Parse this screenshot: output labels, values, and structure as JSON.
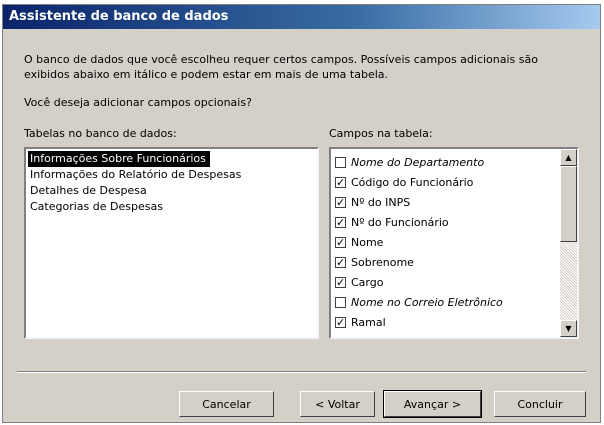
{
  "window": {
    "title": "Assistente de banco de dados"
  },
  "intro": {
    "line1": "O banco de dados que você escolheu requer certos campos. Possíveis campos adicionais são",
    "line2": "exibidos abaixo em itálico e podem estar em mais de uma tabela."
  },
  "question": "Você deseja adicionar campos opcionais?",
  "tables": {
    "label": "Tabelas no banco de dados:",
    "items": [
      {
        "label": "Informações Sobre Funcionários",
        "selected": true
      },
      {
        "label": "Informações do Relatório de Despesas",
        "selected": false
      },
      {
        "label": "Detalhes de Despesa",
        "selected": false
      },
      {
        "label": "Categorias de Despesas",
        "selected": false
      }
    ]
  },
  "fields": {
    "label": "Campos na tabela:",
    "items": [
      {
        "label": "Nome do Departamento",
        "checked": false,
        "optional": true
      },
      {
        "label": "Código do Funcionário",
        "checked": true,
        "optional": false
      },
      {
        "label": "Nº do INPS",
        "checked": true,
        "optional": false
      },
      {
        "label": "Nº do Funcionário",
        "checked": true,
        "optional": false
      },
      {
        "label": "Nome",
        "checked": true,
        "optional": false
      },
      {
        "label": "Sobrenome",
        "checked": true,
        "optional": false
      },
      {
        "label": "Cargo",
        "checked": true,
        "optional": false
      },
      {
        "label": "Nome no Correio Eletrônico",
        "checked": false,
        "optional": true
      },
      {
        "label": "Ramal",
        "checked": true,
        "optional": false
      }
    ]
  },
  "buttons": {
    "cancel": "Cancelar",
    "back": "< Voltar",
    "next": "Avançar >",
    "finish": "Concluir"
  },
  "icons": {
    "scroll_up": "▲",
    "scroll_down": "▼",
    "check": "✓"
  }
}
